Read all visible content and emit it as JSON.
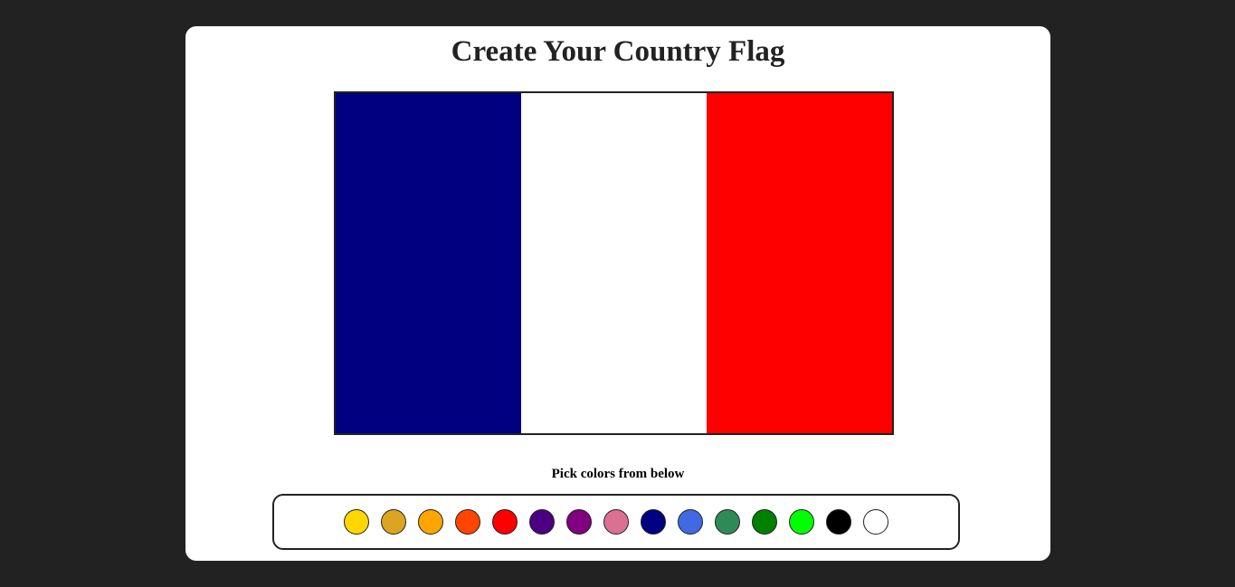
{
  "page": {
    "title": "Create Your Country Flag",
    "instruction": "Pick colors from below"
  },
  "flag": {
    "stripes": [
      {
        "name": "left",
        "color": "#000080"
      },
      {
        "name": "middle",
        "color": "#ffffff"
      },
      {
        "name": "right",
        "color": "#ff0000"
      }
    ]
  },
  "palette": {
    "colors": [
      "#ffd700",
      "#daa520",
      "#ffa500",
      "#ff4500",
      "#ff0000",
      "#4b0082",
      "#800080",
      "#db7093",
      "#000080",
      "#4169e1",
      "#2e8b57",
      "#008000",
      "#00ff00",
      "#000000",
      "#ffffff"
    ]
  }
}
